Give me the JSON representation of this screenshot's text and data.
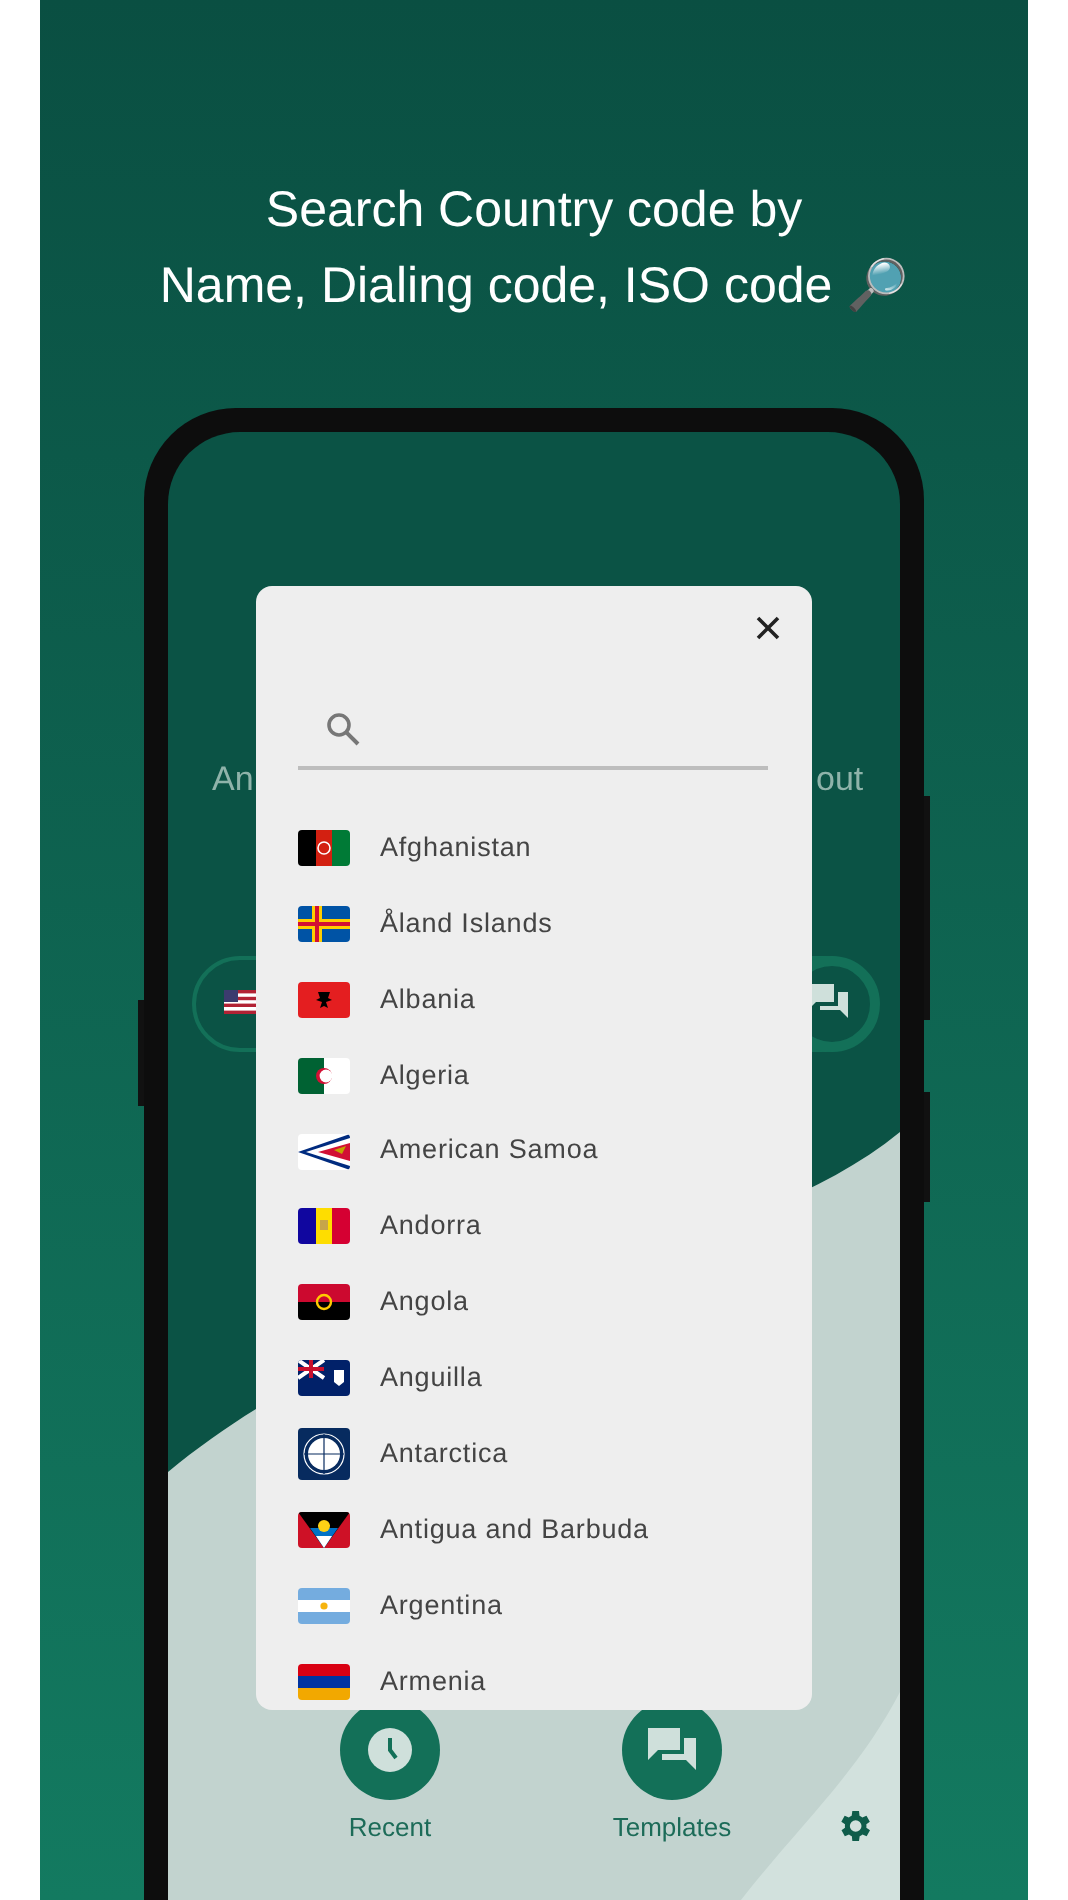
{
  "headline": {
    "lines": [
      "Search Country code by",
      "Name, Dialing code, ISO code 🔎"
    ]
  },
  "background_screen": {
    "text_left": "An",
    "text_right": "out"
  },
  "dialog": {
    "countries": [
      {
        "name": "Afghanistan"
      },
      {
        "name": "Åland Islands"
      },
      {
        "name": "Albania"
      },
      {
        "name": "Algeria"
      },
      {
        "name": "American Samoa"
      },
      {
        "name": "Andorra"
      },
      {
        "name": "Angola"
      },
      {
        "name": "Anguilla"
      },
      {
        "name": "Antarctica"
      },
      {
        "name": "Antigua and Barbuda"
      },
      {
        "name": "Argentina"
      },
      {
        "name": "Armenia"
      }
    ]
  },
  "bottom_actions": [
    {
      "label": "Recent",
      "kind": "clock"
    },
    {
      "label": "Templates",
      "kind": "chat"
    }
  ]
}
